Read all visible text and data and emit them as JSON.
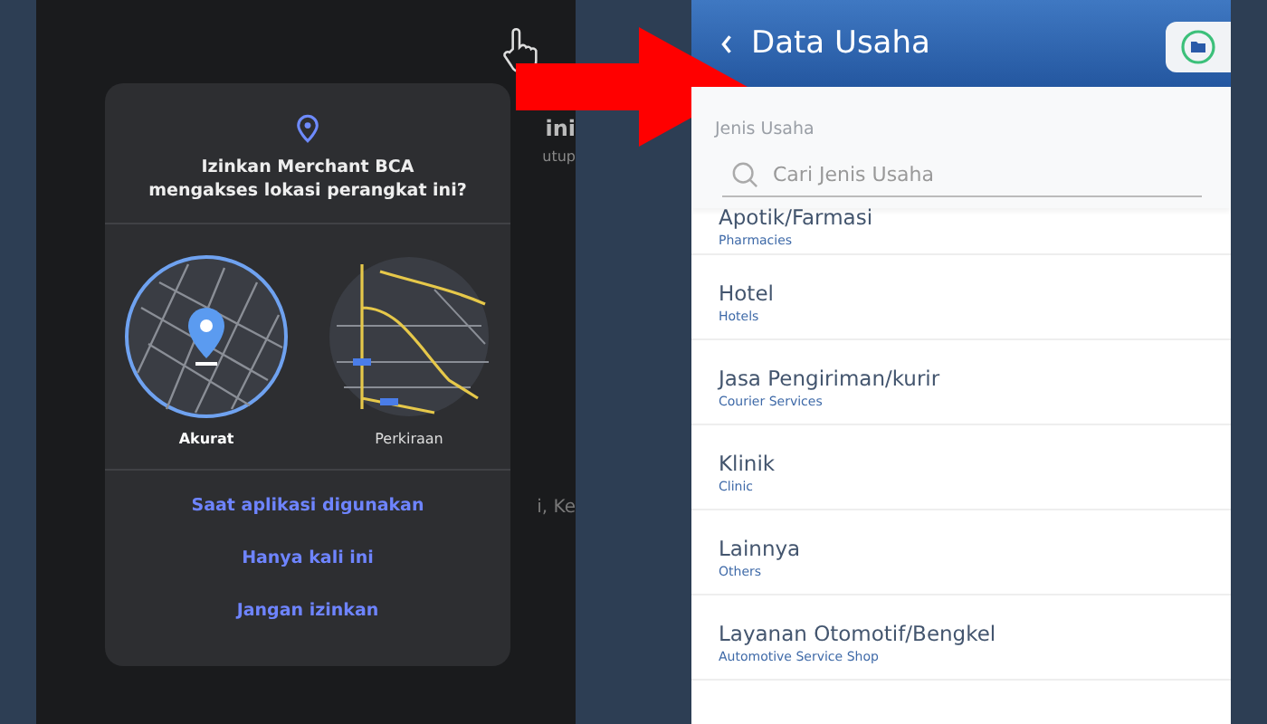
{
  "background_screen": {
    "fragments": [
      {
        "text": "ini",
        "kind": "title"
      },
      {
        "text": "utup",
        "kind": "caption"
      },
      {
        "text": "i, Ke",
        "kind": "field"
      }
    ]
  },
  "permission_dialog": {
    "title": "Izinkan Merchant BCA mengakses lokasi perangkat ini?",
    "options": [
      {
        "label": "Akurat"
      },
      {
        "label": "Perkiraan"
      }
    ],
    "buttons": [
      "Saat aplikasi digunakan",
      "Hanya kali ini",
      "Jangan izinkan"
    ]
  },
  "app": {
    "title": "Data Usaha",
    "section_label": "Jenis Usaha",
    "search": {
      "placeholder": "Cari Jenis Usaha"
    },
    "items": [
      {
        "name": "Apotik/Farmasi",
        "subtitle": "Pharmacies"
      },
      {
        "name": "Hotel",
        "subtitle": "Hotels"
      },
      {
        "name": "Jasa Pengiriman/kurir",
        "subtitle": "Courier Services"
      },
      {
        "name": "Klinik",
        "subtitle": "Clinic"
      },
      {
        "name": "Lainnya",
        "subtitle": "Others"
      },
      {
        "name": "Layanan Otomotif/Bengkel",
        "subtitle": "Automotive Service Shop"
      }
    ]
  }
}
